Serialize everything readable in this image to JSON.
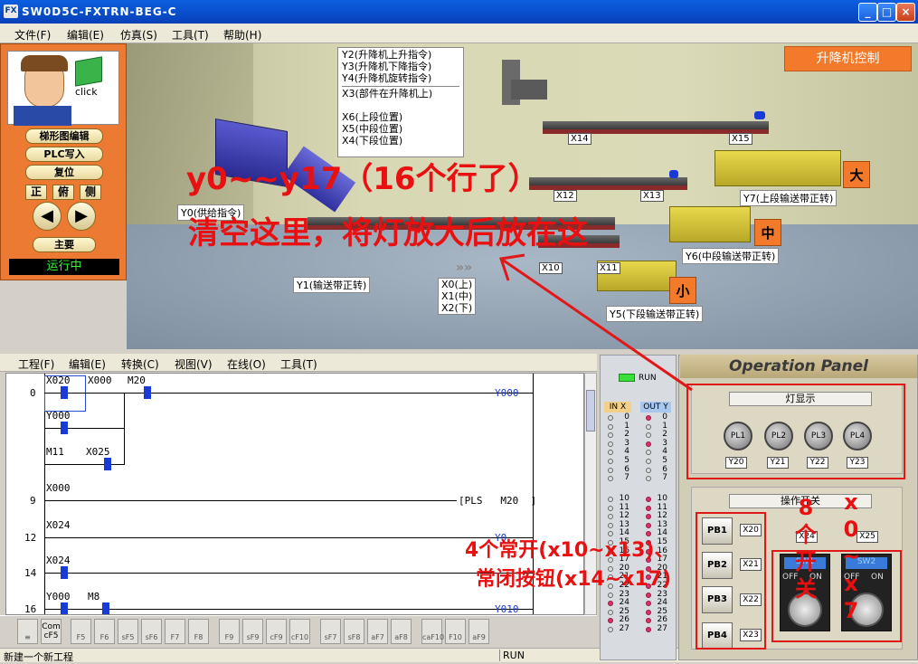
{
  "window": {
    "title": "SW0D5C-FXTRN-BEG-C",
    "icon": "FX",
    "buttons": {
      "min": "_",
      "max": "□",
      "close": "×"
    }
  },
  "menu": [
    "文件(F)",
    "编辑(E)",
    "仿真(S)",
    "工具(T)",
    "帮助(H)"
  ],
  "sidebar": {
    "click_label": "click",
    "buttons": [
      "梯形图编辑",
      "PLC写入",
      "复位"
    ],
    "views": [
      "正",
      "俯",
      "侧"
    ],
    "main_label": "主要",
    "status": "运行中"
  },
  "scene": {
    "lift_control": "升降机控制",
    "info_lines": [
      "Y2(升降机上升指令)",
      "Y3(升降机下降指令)",
      "Y4(升降机旋转指令)",
      "X3(部件在升降机上)",
      "X6(上段位置)",
      "X5(中段位置)",
      "X4(下段位置)"
    ],
    "y0_label": "Y0(供给指令)",
    "y1_label": "Y1(输送带正转)",
    "x_pos": [
      "X0(上)",
      "X1(中)",
      "X2(下)"
    ],
    "sensors": [
      "X14",
      "X15",
      "X12",
      "X13",
      "X10",
      "X11"
    ],
    "y7_label": "Y7(上段输送带正转)",
    "y6_label": "Y6(中段输送带正转)",
    "y5_label": "Y5(下段输送带正转)",
    "sizes": [
      "大",
      "中",
      "小"
    ]
  },
  "menu2": [
    "工程(F)",
    "编辑(E)",
    "转换(C)",
    "视图(V)",
    "在线(O)",
    "工具(T)"
  ],
  "ladder": {
    "steps": [
      "0",
      "9",
      "12",
      "14",
      "16"
    ],
    "contacts": [
      "X020",
      "X000",
      "M20",
      "Y000",
      "M11",
      "X025",
      "X000",
      "X024",
      "X024",
      "Y000",
      "M8"
    ],
    "coils": [
      "Y000",
      "PLS",
      "M20",
      "Y0",
      "Y010"
    ]
  },
  "fkeys": [
    "Com cF5",
    "F5",
    "F6",
    "sF5",
    "sF6",
    "F7",
    "F8",
    "F9",
    "sF9",
    "cF9",
    "cF10",
    "sF7",
    "sF8",
    "aF7",
    "aF8",
    "caF10",
    "F10",
    "aF9"
  ],
  "status": {
    "left": "新建一个新工程",
    "mode": "RUN"
  },
  "io": {
    "run": "RUN",
    "in_label": "IN X",
    "out_label": "OUT Y",
    "rows_a": [
      "0",
      "1",
      "2",
      "3",
      "4",
      "5",
      "6",
      "7"
    ],
    "rows_b": [
      "10",
      "11",
      "12",
      "13",
      "14",
      "15",
      "16",
      "17",
      "20",
      "21",
      "22",
      "23",
      "24",
      "25",
      "26",
      "27"
    ],
    "in_on": [
      "24",
      "26"
    ],
    "out_on": [
      "0",
      "3",
      "10",
      "11",
      "12",
      "13",
      "14",
      "15",
      "16",
      "17",
      "20",
      "21",
      "22",
      "23",
      "24",
      "25",
      "26",
      "27"
    ]
  },
  "panel": {
    "title": "Operation Panel",
    "lamp_label": "灯显示",
    "lamps": [
      "PL1",
      "PL2",
      "PL3",
      "PL4"
    ],
    "lamp_y": [
      "Y20",
      "Y21",
      "Y22",
      "Y23"
    ],
    "switch_label": "操作开关",
    "x24": "X24",
    "x25": "X25",
    "pbs": [
      "PB1",
      "PB2",
      "PB3",
      "PB4"
    ],
    "pb_x": [
      "X20",
      "X21",
      "X22",
      "X23"
    ],
    "sws": [
      "SW1",
      "SW2"
    ],
    "off": "OFF",
    "on": "ON"
  },
  "annotations": {
    "a1": "y0~~y17（16个行了）",
    "a2": "清空这里，将灯放大后放在这",
    "a3": "4个常开(x10~x13)、",
    "a4": "常闭按钮(x14~x17)",
    "a5": "8个开关",
    "a6": "x0~x7"
  }
}
